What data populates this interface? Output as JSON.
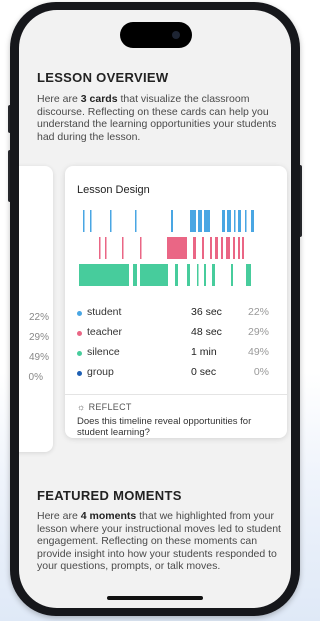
{
  "overview": {
    "title": "LESSON OVERVIEW",
    "text_1": "Here are ",
    "text_bold": "3 cards",
    "text_2": " that visualize the classroom discourse. Reflecting on these cards can help you understand the learning opportunities your students had during the lesson."
  },
  "left_card": {
    "percents": [
      "22%",
      "29%",
      "49%",
      "0%"
    ]
  },
  "card": {
    "title": "Lesson Design",
    "legend": [
      {
        "label": "student",
        "value": "36 sec",
        "percent": "22%",
        "color": "#49a6e3"
      },
      {
        "label": "teacher",
        "value": "48 sec",
        "percent": "29%",
        "color": "#ea6685"
      },
      {
        "label": "silence",
        "value": "1 min",
        "percent": "49%",
        "color": "#47cc9c"
      },
      {
        "label": "group",
        "value": "0 sec",
        "percent": "0%",
        "color": "#1e5fb3"
      }
    ],
    "reflect_label": "REFLECT",
    "reflect_icon": "lightbulb-icon",
    "reflect_question": "Does this timeline reveal opportunities for student learning?"
  },
  "featured": {
    "title": "FEATURED MOMENTS",
    "text_1": "Here are ",
    "text_bold": "4 moments",
    "text_2": " that we highlighted from your lesson where your instructional moves led to student engagement. Reflecting on these moments can provide insight into how your students responded to your questions, prompts, or talk moves."
  }
}
